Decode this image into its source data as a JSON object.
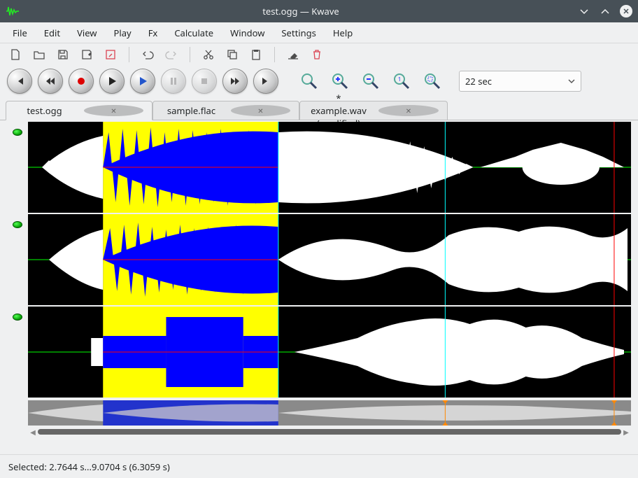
{
  "window": {
    "title": "test.ogg — Kwave"
  },
  "menu": {
    "file": "File",
    "edit": "Edit",
    "view": "View",
    "play": "Play",
    "fx": "Fx",
    "calculate": "Calculate",
    "window": "Window",
    "settings": "Settings",
    "help": "Help"
  },
  "zoom": {
    "selected": "22 sec"
  },
  "tabs": [
    {
      "label": "test.ogg",
      "active": true
    },
    {
      "label": "sample.flac",
      "active": false
    },
    {
      "label": "* example.wav (modified)",
      "active": false
    }
  ],
  "tracks": 3,
  "status": {
    "text": "Selected: 2.7644 s...9.0704 s (6.3059 s)"
  },
  "colors": {
    "waveform": "#ffffff",
    "waveform_selected": "#0000ff",
    "selection_bg": "#ffff00",
    "centerline": "#00ff00",
    "marker": "#00ffff",
    "cursor_label": "#ff0000"
  },
  "selection": {
    "start_frac": 0.125,
    "end_frac": 0.415
  },
  "marker_frac": 0.69,
  "cursor_frac": 0.965
}
